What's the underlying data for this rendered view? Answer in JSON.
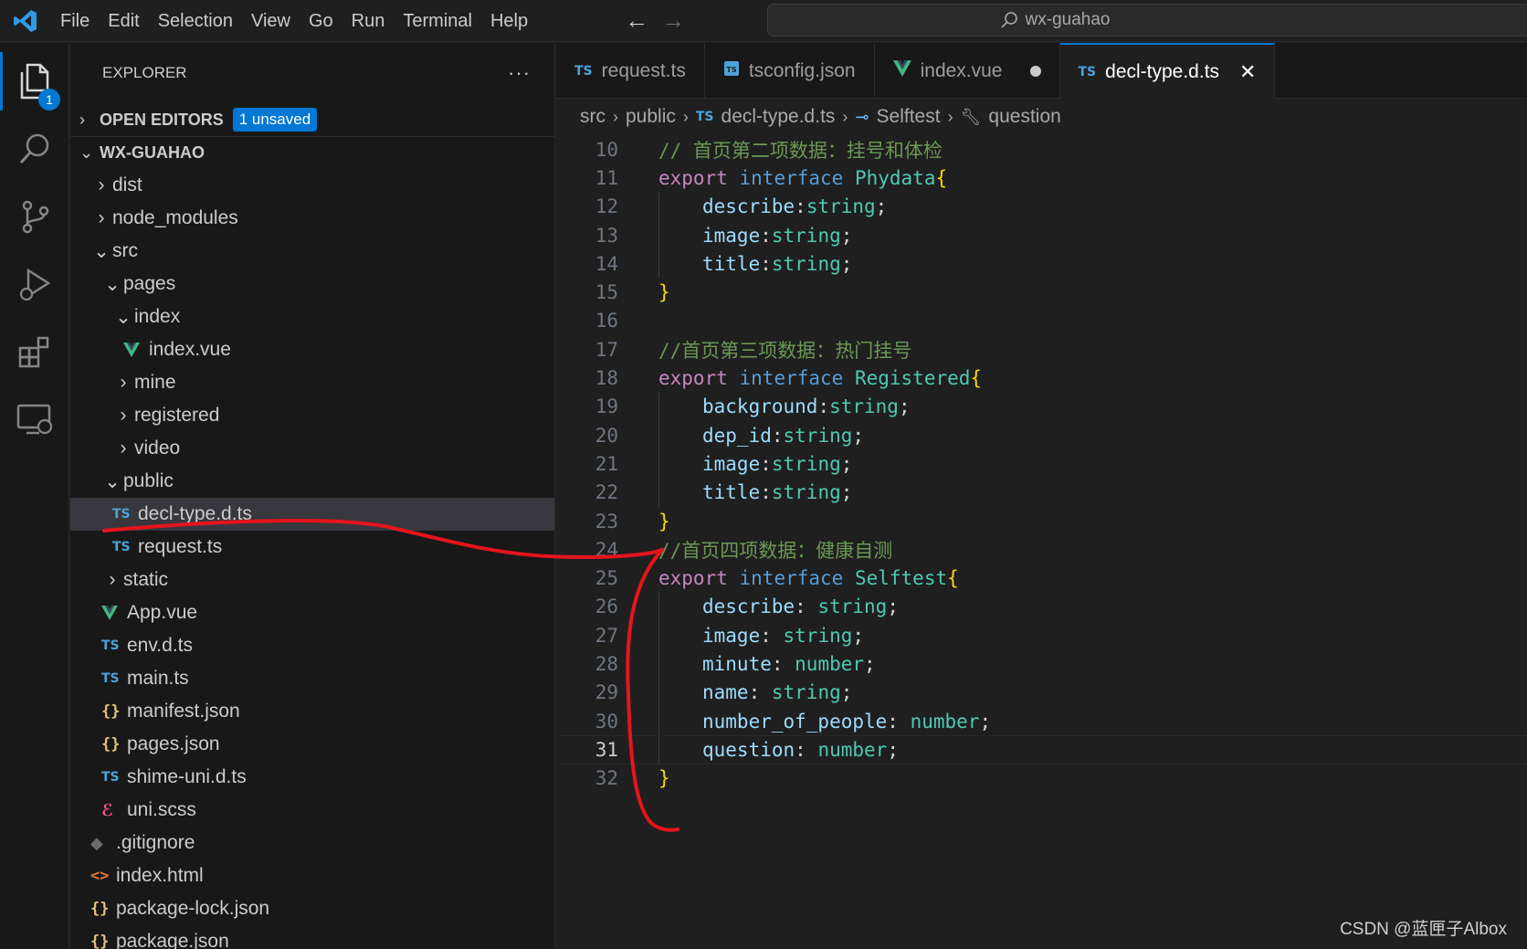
{
  "menu": [
    "File",
    "Edit",
    "Selection",
    "View",
    "Go",
    "Run",
    "Terminal",
    "Help"
  ],
  "search": {
    "text": "wx-guahao"
  },
  "activity": {
    "badge": "1"
  },
  "explorer": {
    "title": "EXPLORER",
    "open_editors": "OPEN EDITORS",
    "unsaved": "1 unsaved",
    "project": "WX-GUAHAO",
    "tree": [
      {
        "label": "dist",
        "depth": 0,
        "type": "folder",
        "open": false
      },
      {
        "label": "node_modules",
        "depth": 0,
        "type": "folder",
        "open": false
      },
      {
        "label": "src",
        "depth": 0,
        "type": "folder",
        "open": true
      },
      {
        "label": "pages",
        "depth": 1,
        "type": "folder",
        "open": true
      },
      {
        "label": "index",
        "depth": 2,
        "type": "folder",
        "open": true
      },
      {
        "label": "index.vue",
        "depth": 3,
        "type": "vue"
      },
      {
        "label": "mine",
        "depth": 2,
        "type": "folder",
        "open": false
      },
      {
        "label": "registered",
        "depth": 2,
        "type": "folder",
        "open": false
      },
      {
        "label": "video",
        "depth": 2,
        "type": "folder",
        "open": false
      },
      {
        "label": "public",
        "depth": 1,
        "type": "folder",
        "open": true
      },
      {
        "label": "decl-type.d.ts",
        "depth": 2,
        "type": "ts",
        "selected": true
      },
      {
        "label": "request.ts",
        "depth": 2,
        "type": "ts"
      },
      {
        "label": "static",
        "depth": 1,
        "type": "folder",
        "open": false
      },
      {
        "label": "App.vue",
        "depth": 1,
        "type": "vue"
      },
      {
        "label": "env.d.ts",
        "depth": 1,
        "type": "ts"
      },
      {
        "label": "main.ts",
        "depth": 1,
        "type": "ts"
      },
      {
        "label": "manifest.json",
        "depth": 1,
        "type": "json"
      },
      {
        "label": "pages.json",
        "depth": 1,
        "type": "json"
      },
      {
        "label": "shime-uni.d.ts",
        "depth": 1,
        "type": "ts"
      },
      {
        "label": "uni.scss",
        "depth": 1,
        "type": "scss"
      },
      {
        "label": ".gitignore",
        "depth": 0,
        "type": "git"
      },
      {
        "label": "index.html",
        "depth": 0,
        "type": "html"
      },
      {
        "label": "package-lock.json",
        "depth": 0,
        "type": "json"
      },
      {
        "label": "package.json",
        "depth": 0,
        "type": "json"
      }
    ]
  },
  "tabs": [
    {
      "label": "request.ts",
      "type": "ts"
    },
    {
      "label": "tsconfig.json",
      "type": "tsconfig"
    },
    {
      "label": "index.vue",
      "type": "vue",
      "dirty": true
    },
    {
      "label": "decl-type.d.ts",
      "type": "ts",
      "active": true
    }
  ],
  "breadcrumb": {
    "p1": "src",
    "p2": "public",
    "file": "decl-type.d.ts",
    "symbol": "Selftest",
    "member": "question"
  },
  "code": [
    {
      "n": "10",
      "indent": false,
      "tokens": [
        [
          "cm",
          "// 首页第二项数据：挂号和体检"
        ]
      ]
    },
    {
      "n": "11",
      "indent": false,
      "tokens": [
        [
          "kw",
          "export"
        ],
        [
          "sp",
          " "
        ],
        [
          "kw2",
          "interface"
        ],
        [
          "sp",
          " "
        ],
        [
          "tname",
          "Phydata"
        ],
        [
          "br",
          "{"
        ]
      ]
    },
    {
      "n": "12",
      "indent": true,
      "tokens": [
        [
          "prop",
          "describe"
        ],
        [
          "punct",
          ":"
        ],
        [
          "tname",
          "string"
        ],
        [
          "punct",
          ";"
        ]
      ]
    },
    {
      "n": "13",
      "indent": true,
      "tokens": [
        [
          "prop",
          "image"
        ],
        [
          "punct",
          ":"
        ],
        [
          "tname",
          "string"
        ],
        [
          "punct",
          ";"
        ]
      ]
    },
    {
      "n": "14",
      "indent": true,
      "tokens": [
        [
          "prop",
          "title"
        ],
        [
          "punct",
          ":"
        ],
        [
          "tname",
          "string"
        ],
        [
          "punct",
          ";"
        ]
      ]
    },
    {
      "n": "15",
      "indent": false,
      "tokens": [
        [
          "br",
          "}"
        ]
      ]
    },
    {
      "n": "16",
      "indent": false,
      "tokens": []
    },
    {
      "n": "17",
      "indent": false,
      "tokens": [
        [
          "cm",
          "//首页第三项数据：热门挂号"
        ]
      ]
    },
    {
      "n": "18",
      "indent": false,
      "tokens": [
        [
          "kw",
          "export"
        ],
        [
          "sp",
          " "
        ],
        [
          "kw2",
          "interface"
        ],
        [
          "sp",
          " "
        ],
        [
          "tname",
          "Registered"
        ],
        [
          "br",
          "{"
        ]
      ]
    },
    {
      "n": "19",
      "indent": true,
      "tokens": [
        [
          "prop",
          "background"
        ],
        [
          "punct",
          ":"
        ],
        [
          "tname",
          "string"
        ],
        [
          "punct",
          ";"
        ]
      ]
    },
    {
      "n": "20",
      "indent": true,
      "tokens": [
        [
          "prop",
          "dep_id"
        ],
        [
          "punct",
          ":"
        ],
        [
          "tname",
          "string"
        ],
        [
          "punct",
          ";"
        ]
      ]
    },
    {
      "n": "21",
      "indent": true,
      "tokens": [
        [
          "prop",
          "image"
        ],
        [
          "punct",
          ":"
        ],
        [
          "tname",
          "string"
        ],
        [
          "punct",
          ";"
        ]
      ]
    },
    {
      "n": "22",
      "indent": true,
      "tokens": [
        [
          "prop",
          "title"
        ],
        [
          "punct",
          ":"
        ],
        [
          "tname",
          "string"
        ],
        [
          "punct",
          ";"
        ]
      ]
    },
    {
      "n": "23",
      "indent": false,
      "tokens": [
        [
          "br",
          "}"
        ]
      ]
    },
    {
      "n": "24",
      "indent": false,
      "tokens": [
        [
          "cm",
          "//首页四项数据：健康自测"
        ]
      ]
    },
    {
      "n": "25",
      "indent": false,
      "tokens": [
        [
          "kw",
          "export"
        ],
        [
          "sp",
          " "
        ],
        [
          "kw2",
          "interface"
        ],
        [
          "sp",
          " "
        ],
        [
          "tname",
          "Selftest"
        ],
        [
          "br",
          "{"
        ]
      ]
    },
    {
      "n": "26",
      "indent": true,
      "tokens": [
        [
          "prop",
          "describe"
        ],
        [
          "punct",
          ": "
        ],
        [
          "tname",
          "string"
        ],
        [
          "punct",
          ";"
        ]
      ]
    },
    {
      "n": "27",
      "indent": true,
      "tokens": [
        [
          "prop",
          "image"
        ],
        [
          "punct",
          ": "
        ],
        [
          "tname",
          "string"
        ],
        [
          "punct",
          ";"
        ]
      ]
    },
    {
      "n": "28",
      "indent": true,
      "tokens": [
        [
          "prop",
          "minute"
        ],
        [
          "punct",
          ": "
        ],
        [
          "tname",
          "number"
        ],
        [
          "punct",
          ";"
        ]
      ]
    },
    {
      "n": "29",
      "indent": true,
      "tokens": [
        [
          "prop",
          "name"
        ],
        [
          "punct",
          ": "
        ],
        [
          "tname",
          "string"
        ],
        [
          "punct",
          ";"
        ]
      ]
    },
    {
      "n": "30",
      "indent": true,
      "tokens": [
        [
          "prop",
          "number_of_people"
        ],
        [
          "punct",
          ": "
        ],
        [
          "tname",
          "number"
        ],
        [
          "punct",
          ";"
        ]
      ]
    },
    {
      "n": "31",
      "indent": true,
      "current": true,
      "tokens": [
        [
          "prop",
          "question"
        ],
        [
          "punct",
          ": "
        ],
        [
          "tname",
          "number"
        ],
        [
          "punct",
          ";"
        ]
      ]
    },
    {
      "n": "32",
      "indent": false,
      "tokens": [
        [
          "br",
          "}"
        ]
      ]
    }
  ],
  "watermark": "CSDN @蓝匣子Albox",
  "colors": {
    "accent": "#0078d4",
    "annotation": "#e5141b",
    "vue": "#41b883"
  }
}
